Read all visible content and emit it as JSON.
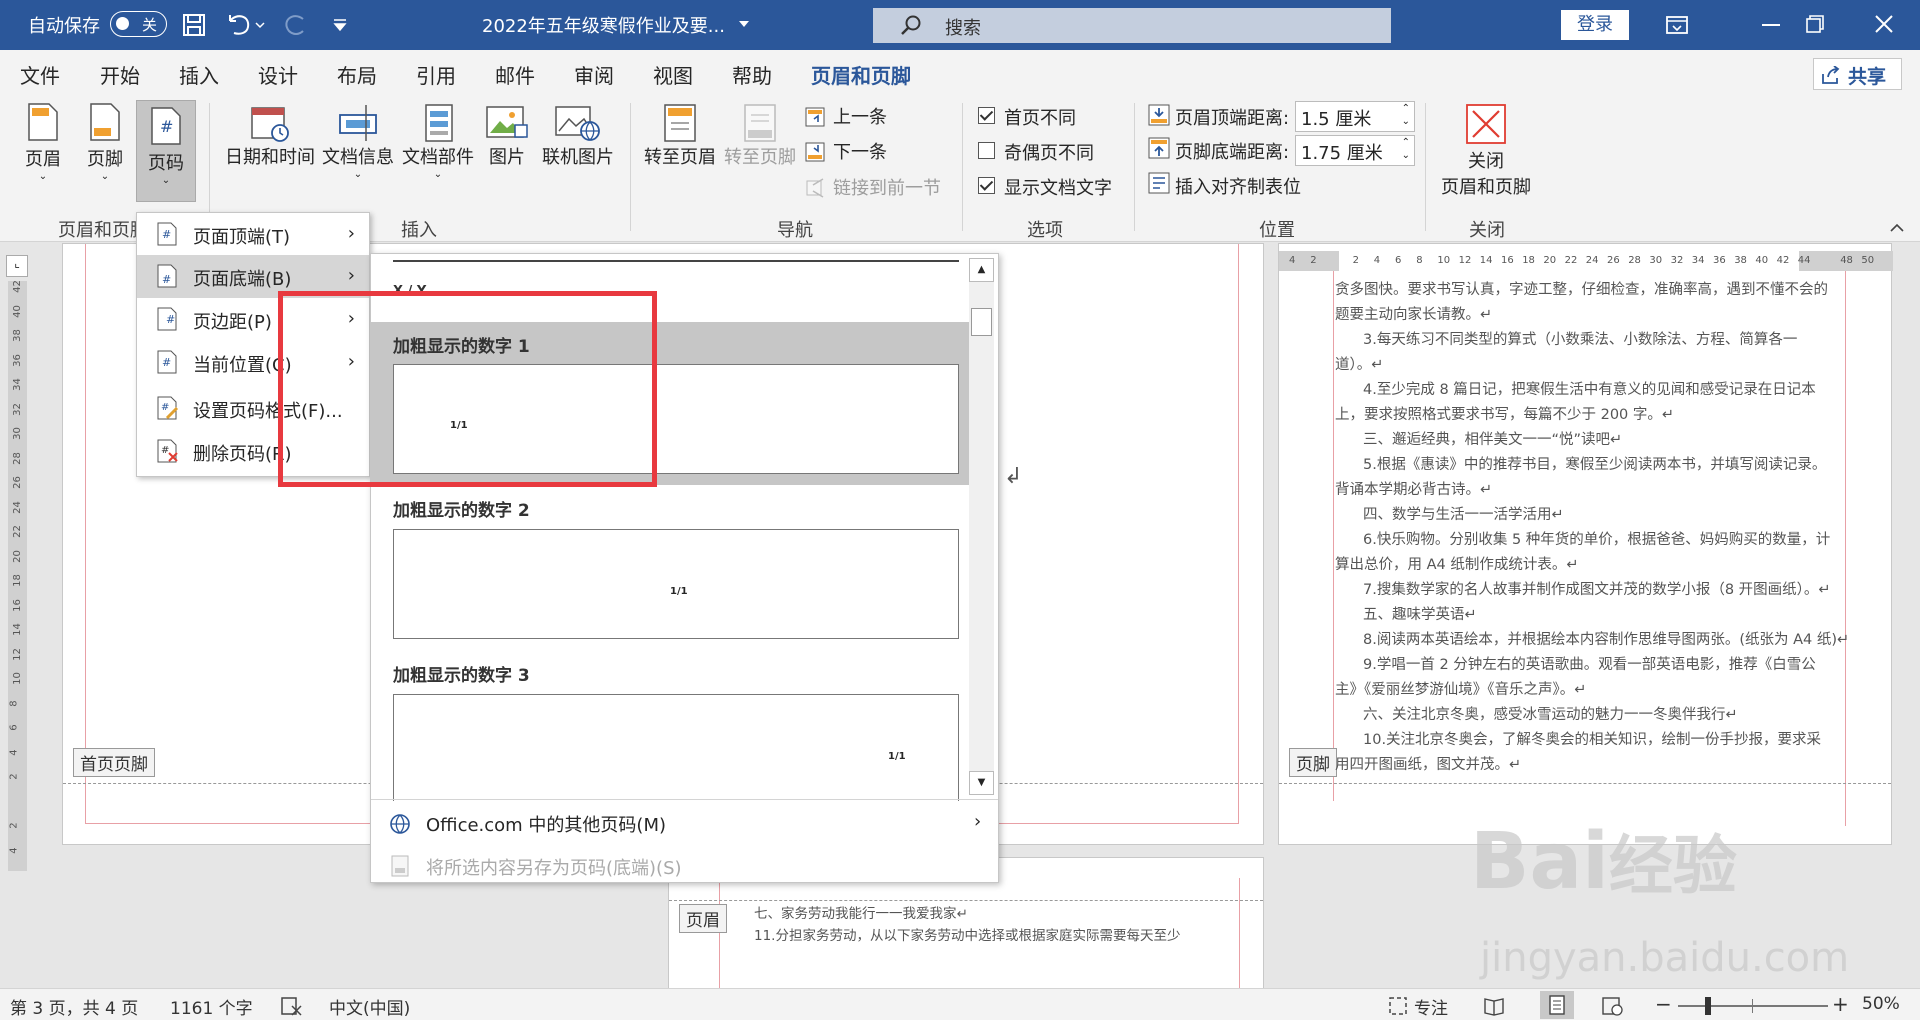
{
  "titlebar": {
    "autosave_label": "自动保存",
    "autosave_state": "关",
    "doc_title": "2022年五年级寒假作业及要...",
    "search_placeholder": "搜索",
    "login": "登录"
  },
  "tabs": [
    "文件",
    "开始",
    "插入",
    "设计",
    "布局",
    "引用",
    "邮件",
    "审阅",
    "视图",
    "帮助",
    "页眉和页脚"
  ],
  "share": "共享",
  "ribbon": {
    "hf_group": {
      "header": "页眉",
      "footer": "页脚",
      "page_number": "页码",
      "label": "页眉和页脚"
    },
    "insert_group": {
      "datetime": "日期和时间",
      "docinfo": "文档信息",
      "docparts": "文档部件",
      "picture": "图片",
      "online_picture": "联机图片",
      "label": "插入"
    },
    "nav_group": {
      "goto_header": "转至页眉",
      "goto_footer": "转至页脚",
      "prev": "上一条",
      "next": "下一条",
      "link_prev": "链接到前一节",
      "label": "导航"
    },
    "options_group": {
      "first_diff": "首页不同",
      "odd_even": "奇偶页不同",
      "show_text": "显示文档文字",
      "label": "选项"
    },
    "position_group": {
      "header_top": "页眉顶端距离:",
      "header_top_val": "1.5 厘米",
      "footer_bottom": "页脚底端距离:",
      "footer_bottom_val": "1.75 厘米",
      "align_tab": "插入对齐制表位",
      "label": "位置"
    },
    "close_group": {
      "close_l1": "关闭",
      "close_l2": "页眉和页脚",
      "label": "关闭"
    }
  },
  "menu": [
    "页面顶端(T)",
    "页面底端(B)",
    "页边距(P)",
    "当前位置(C)",
    "设置页码格式(F)...",
    "删除页码(R)"
  ],
  "gallery": {
    "partial_title": "X / Y",
    "items": [
      {
        "title": "加粗显示的数字 1",
        "sample": "1/1"
      },
      {
        "title": "加粗显示的数字 2",
        "sample": "1/1"
      },
      {
        "title": "加粗显示的数字 3",
        "sample": "1/1"
      }
    ],
    "more": "Office.com 中的其他页码(M)",
    "save": "将所选内容另存为页码(底端)(S)"
  },
  "doc": {
    "left_tag": "首页页脚",
    "right_tag": "页脚",
    "bottom_tag": "页眉",
    "right_lines": [
      "贪多图快。要求书写认真，字迹工整，仔细检查，准确率高，遇到不懂不会的",
      "题要主动向家长请教。↵",
      "3.每天练习不同类型的算式（小数乘法、小数除法、方程、简算各一",
      "道）。↵",
      "4.至少完成 8 篇日记，把寒假生活中有意义的见闻和感受记录在日记本",
      "上，要求按照格式要求书写，每篇不少于 200 字。↵",
      "三、邂逅经典，相伴美文一一“悦”读吧↵",
      "5.根据《惠读》中的推荐书目，寒假至少阅读两本书，并填写阅读记录。",
      "背诵本学期必背古诗。↵",
      "四、数学与生活一一活学活用↵",
      "6.快乐购物。分别收集 5 种年货的单价，根据爸爸、妈妈购买的数量，计",
      "算出总价，用 A4 纸制作成统计表。↵",
      "7.搜集数学家的名人故事并制作成图文并茂的数学小报（8 开图画纸）。↵",
      "五、趣味学英语↵",
      "8.阅读两本英语绘本，并根据绘本内容制作思维导图两张。(纸张为 A4 纸)↵",
      "9.学唱一首 2 分钟左右的英语歌曲。观看一部英语电影，推荐《白雪公",
      "主》《爱丽丝梦游仙境》《音乐之声》。↵",
      "六、关注北京冬奥，感受冰雪运动的魅力一一冬奥伴我行↵",
      "10.关注北京冬奥会，了解冬奥会的相关知识，绘制一份手抄报，要求采",
      "用四开图画纸，图文并茂。↵"
    ],
    "bottom_lines": [
      "七、家务劳动我能行一一我爱我家↵",
      "11.分担家务劳动，从以下家务劳动中选择或根据家庭实际需要每天至少"
    ],
    "ruler_nums": [
      "4",
      "2",
      "",
      "2",
      "4",
      "6",
      "8",
      "10",
      "12",
      "14",
      "16",
      "18",
      "20",
      "22",
      "24",
      "26",
      "28",
      "30",
      "32",
      "34",
      "36",
      "38",
      "40",
      "42",
      "44",
      "",
      "48",
      "50"
    ],
    "vruler_nums": [
      "42",
      "40",
      "38",
      "36",
      "34",
      "32",
      "30",
      "28",
      "26",
      "24",
      "22",
      "20",
      "18",
      "16",
      "14",
      "12",
      "10",
      "8",
      "6",
      "4",
      "2",
      "",
      "2",
      "4"
    ]
  },
  "status": {
    "page": "第 3 页，共 4 页",
    "words": "1161 个字",
    "lang": "中文(中国)",
    "focus": "专注",
    "zoom": "50%"
  },
  "watermark": {
    "main": "Bai",
    "brand": "经验",
    "sub": "jingyan.baidu.com"
  }
}
